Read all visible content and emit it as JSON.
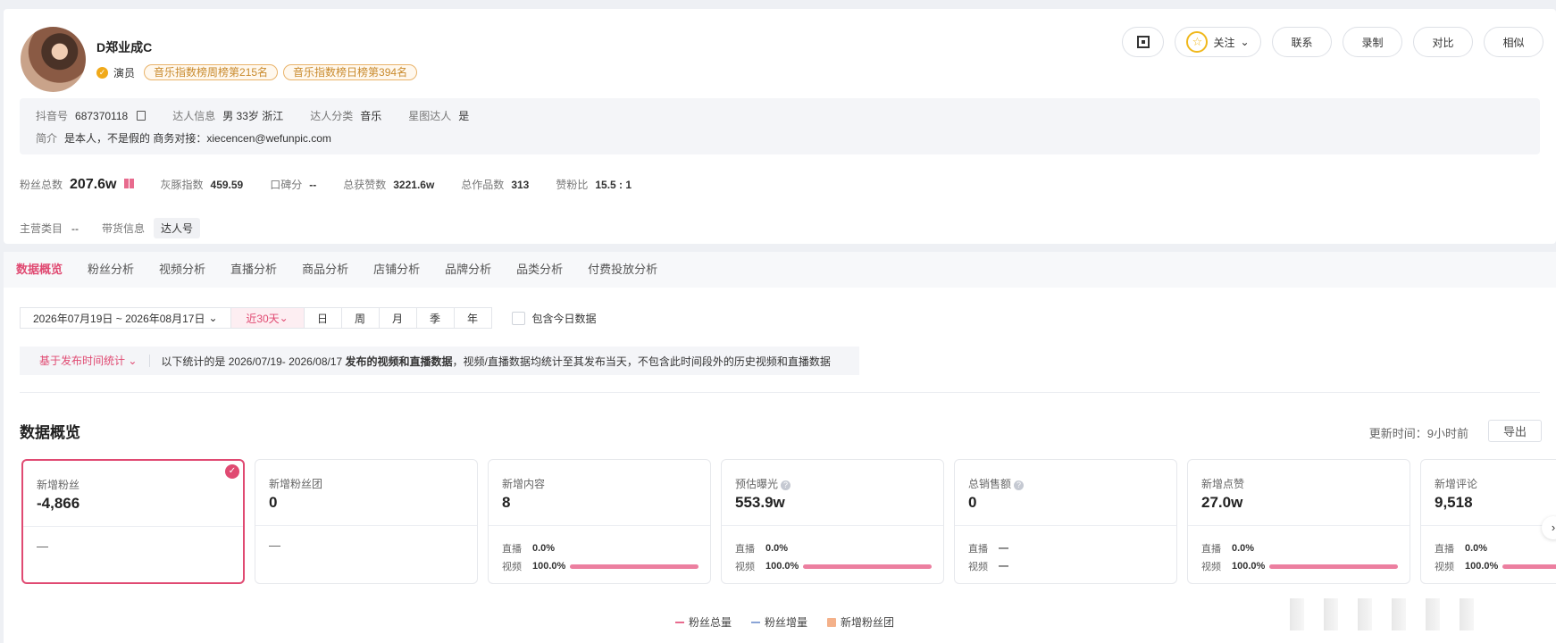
{
  "profile": {
    "name": "D郑业成C",
    "role": "演员",
    "rank_tags": [
      "音乐指数榜周榜第215名",
      "音乐指数榜日榜第394名"
    ],
    "actions": {
      "follow": "关注",
      "contact": "联系",
      "record": "录制",
      "compare": "对比",
      "similar": "相似"
    },
    "info": {
      "douyin_label": "抖音号",
      "douyin_value": "687370118",
      "creator_label": "达人信息",
      "creator_value": "男 33岁 浙江",
      "category_label": "达人分类",
      "category_value": "音乐",
      "star_label": "星图达人",
      "star_value": "是",
      "bio_label": "简介",
      "bio_value": "是本人，不是假的 商务对接：xiecencen@wefunpic.com"
    },
    "stats": [
      {
        "label": "粉丝总数",
        "value": "207.6w"
      },
      {
        "label": "灰豚指数",
        "value": "459.59"
      },
      {
        "label": "口碑分",
        "value": "--"
      },
      {
        "label": "总获赞数",
        "value": "3221.6w"
      },
      {
        "label": "总作品数",
        "value": "313"
      },
      {
        "label": "赞粉比",
        "value": "15.5 : 1"
      }
    ],
    "main_category_label": "主营类目",
    "main_category_value": "--",
    "goods_label": "带货信息",
    "goods_value": "达人号"
  },
  "tabs": [
    "数据概览",
    "粉丝分析",
    "视频分析",
    "直播分析",
    "商品分析",
    "店铺分析",
    "品牌分析",
    "品类分析",
    "付费投放分析"
  ],
  "filters": {
    "date_range": "2026年07月19日 ~ 2026年08月17日",
    "ranges": [
      "近30天",
      "日",
      "周",
      "月",
      "季",
      "年"
    ],
    "include_today": "包含今日数据"
  },
  "notice": {
    "selector": "基于发布时间统计",
    "text_pre": "以下统计的是 2026/07/19- 2026/08/17 ",
    "text_bold": "发布的视频和直播数据",
    "text_post": "，视频/直播数据均统计至其发布当天，不包含此时间段外的历史视频和直播数据"
  },
  "overview": {
    "title": "数据概览",
    "update": "更新时间：9小时前",
    "export": "导出",
    "sub_labels": {
      "live": "直播",
      "video": "视频"
    },
    "metrics": [
      {
        "label": "新增粉丝",
        "value": "-4,866",
        "dash": "—"
      },
      {
        "label": "新增粉丝团",
        "value": "0",
        "dash": "—"
      },
      {
        "label": "新增内容",
        "value": "8",
        "live": "0.0%",
        "video": "100.0%",
        "video_pct": 100
      },
      {
        "label": "预估曝光",
        "value": "553.9w",
        "live": "0.0%",
        "video": "100.0%",
        "video_pct": 100
      },
      {
        "label": "总销售额",
        "value": "0",
        "live": "—",
        "video": "—"
      },
      {
        "label": "新增点赞",
        "value": "27.0w",
        "live": "0.0%",
        "video": "100.0%",
        "video_pct": 100
      },
      {
        "label": "新增评论",
        "value": "9,518",
        "live": "0.0%",
        "video": "100.0%",
        "video_pct": 100
      }
    ]
  },
  "legend": [
    "粉丝总量",
    "粉丝增量",
    "新增粉丝团"
  ],
  "colors": {
    "accent": "#e04a72",
    "rank_tag": "#c98a2c",
    "bar": "#ec7fa0"
  }
}
